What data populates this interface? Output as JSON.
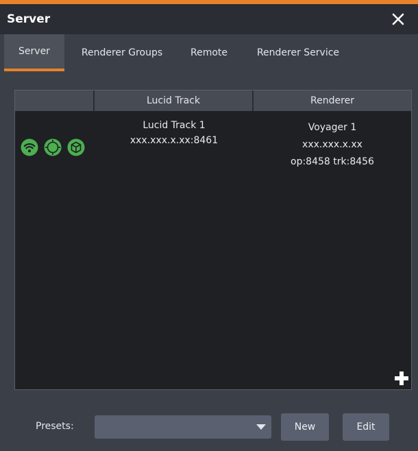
{
  "window": {
    "title": "Server",
    "accent_color": "#e8822a",
    "close_icon": "close-icon"
  },
  "tabs": [
    {
      "label": "Server",
      "active": true
    },
    {
      "label": "Renderer Groups",
      "active": false
    },
    {
      "label": "Remote",
      "active": false
    },
    {
      "label": "Renderer Service",
      "active": false
    }
  ],
  "table": {
    "columns": [
      "",
      "Lucid Track",
      "Renderer"
    ],
    "rows": [
      {
        "status_icons": [
          "wifi-icon",
          "target-icon",
          "cube-icon"
        ],
        "status_color": "#4caf50",
        "lucid_track": {
          "name": "Lucid Track 1",
          "address": "xxx.xxx.x.xx:8461"
        },
        "renderer": {
          "name": "Voyager 1",
          "address": "xxx.xxx.x.xx",
          "ports": "op:8458 trk:8456"
        }
      }
    ],
    "add_icon": "plus-icon"
  },
  "footer": {
    "presets_label": "Presets:",
    "presets_value": "",
    "new_label": "New",
    "edit_label": "Edit"
  }
}
